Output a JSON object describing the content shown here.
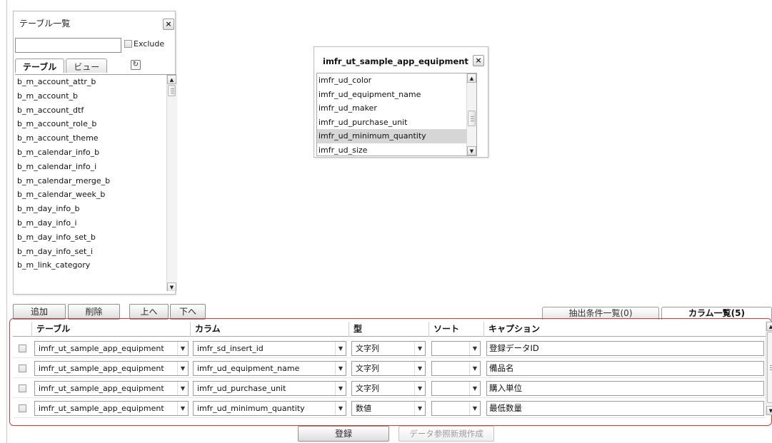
{
  "table_list": {
    "title": "テーブル一覧",
    "filter_value": "",
    "exclude_label": "Exclude",
    "tabs": [
      {
        "label": "テーブル",
        "active": true
      },
      {
        "label": "ビュー",
        "active": false
      }
    ],
    "refresh_icon": "refresh-icon",
    "items": [
      "b_m_account_attr_b",
      "b_m_account_b",
      "b_m_account_dtf",
      "b_m_account_role_b",
      "b_m_account_theme",
      "b_m_calendar_info_b",
      "b_m_calendar_info_i",
      "b_m_calendar_merge_b",
      "b_m_calendar_week_b",
      "b_m_day_info_b",
      "b_m_day_info_i",
      "b_m_day_info_set_b",
      "b_m_day_info_set_i",
      "b_m_link_category"
    ]
  },
  "equipment_panel": {
    "title": "imfr_ut_sample_app_equipment",
    "items": [
      {
        "label": "imfr_ud_color",
        "selected": false
      },
      {
        "label": "imfr_ud_equipment_name",
        "selected": false
      },
      {
        "label": "imfr_ud_maker",
        "selected": false
      },
      {
        "label": "imfr_ud_purchase_unit",
        "selected": false
      },
      {
        "label": "imfr_ud_minimum_quantity",
        "selected": true
      },
      {
        "label": "imfr_ud_size",
        "selected": false
      }
    ]
  },
  "actions": {
    "add": "追加",
    "delete": "削除",
    "up": "上へ",
    "down": "下へ"
  },
  "right_tabs": {
    "filter_list": "抽出条件一覧(0)",
    "column_list": "カラム一覧(5)"
  },
  "grid": {
    "headers": {
      "table": "テーブル",
      "column": "カラム",
      "type": "型",
      "sort": "ソート",
      "caption": "キャプション"
    },
    "rows": [
      {
        "table": "imfr_ut_sample_app_equipment",
        "column": "imfr_sd_insert_id",
        "type": "文字列",
        "sort": "",
        "caption": "登録データID"
      },
      {
        "table": "imfr_ut_sample_app_equipment",
        "column": "imfr_ud_equipment_name",
        "type": "文字列",
        "sort": "",
        "caption": "備品名"
      },
      {
        "table": "imfr_ut_sample_app_equipment",
        "column": "imfr_ud_purchase_unit",
        "type": "文字列",
        "sort": "",
        "caption": "購入単位"
      },
      {
        "table": "imfr_ut_sample_app_equipment",
        "column": "imfr_ud_minimum_quantity",
        "type": "数値",
        "sort": "",
        "caption": "最低数量"
      }
    ]
  },
  "footer": {
    "register": "登録",
    "create_data_reference": "データ参照新規作成"
  },
  "colors": {
    "highlight": "#d23c3c",
    "selected_row": "#d6d6d6"
  }
}
